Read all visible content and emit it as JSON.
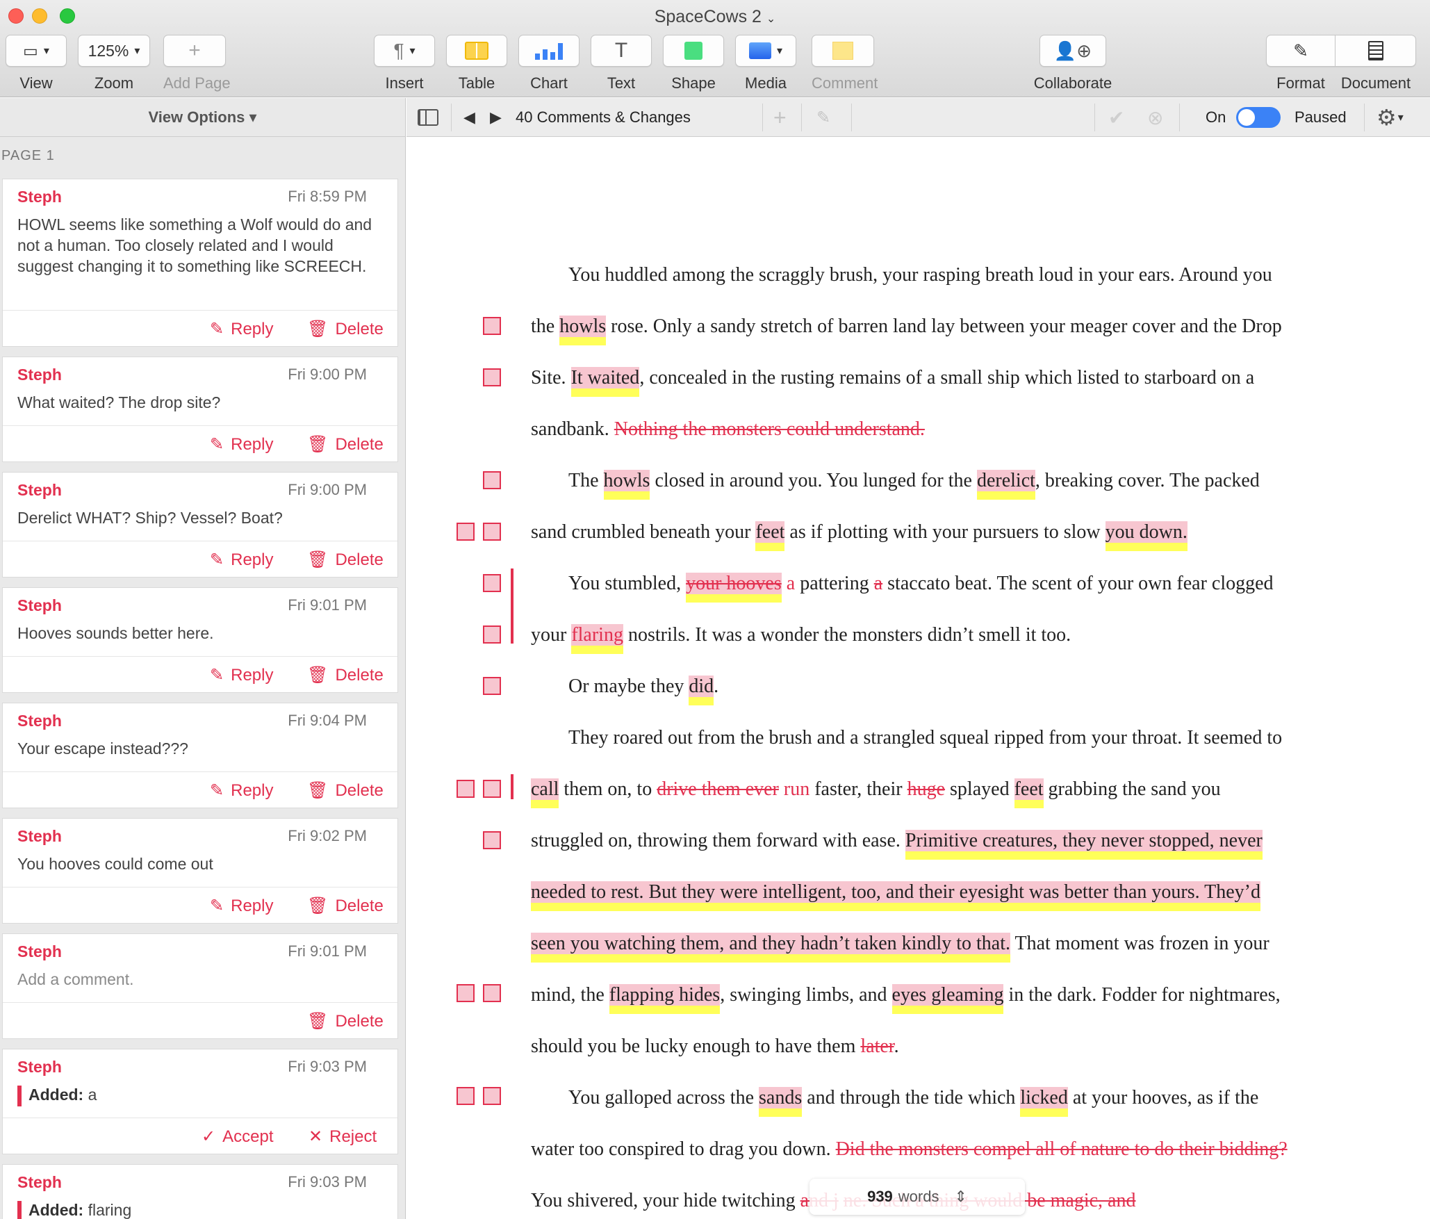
{
  "window": {
    "title": "SpaceCows 2",
    "traffic": [
      "#fd5f57",
      "#febc2e",
      "#29c840"
    ]
  },
  "toolbar": {
    "view": "View",
    "zoom": "Zoom",
    "zoom_value": "125%",
    "add_page": "Add Page",
    "insert": "Insert",
    "table": "Table",
    "chart": "Chart",
    "text": "Text",
    "shape": "Shape",
    "media": "Media",
    "comment": "Comment",
    "collaborate": "Collaborate",
    "format": "Format",
    "document": "Document"
  },
  "sidebar": {
    "view_options": "View Options ▾",
    "page_label": "PAGE 1",
    "reply_label": "Reply",
    "delete_label": "Delete",
    "accept_label": "Accept",
    "reject_label": "Reject",
    "added_label": "Added:",
    "comments": [
      {
        "author": "Steph",
        "time": "Fri 8:59 PM",
        "text": "HOWL seems like something a Wolf would do and not a human. Too closely related and I would suggest changing it to something like SCREECH."
      },
      {
        "author": "Steph",
        "time": "Fri 9:00 PM",
        "text": "What waited? The drop site?"
      },
      {
        "author": "Steph",
        "time": "Fri 9:00 PM",
        "text": "Derelict WHAT? Ship? Vessel? Boat?"
      },
      {
        "author": "Steph",
        "time": "Fri 9:01 PM",
        "text": "Hooves sounds better here."
      },
      {
        "author": "Steph",
        "time": "Fri 9:04 PM",
        "text": "Your escape instead???"
      },
      {
        "author": "Steph",
        "time": "Fri 9:02 PM",
        "text": "You hooves could come out"
      },
      {
        "author": "Steph",
        "time": "Fri 9:01 PM",
        "placeholder": "Add a comment."
      },
      {
        "author": "Steph",
        "time": "Fri 9:03 PM",
        "added": "a"
      },
      {
        "author": "Steph",
        "time": "Fri 9:03 PM",
        "added": "flaring"
      }
    ]
  },
  "comments_bar": {
    "count_label": "40 Comments & Changes",
    "on_label": "On",
    "paused_label": "Paused",
    "tracking_on": true
  },
  "document": {
    "lines": [
      [
        [
          "t",
          "You huddled among the scraggly brush, your rasping breath loud in your ears. Around you"
        ]
      ],
      [
        [
          "t",
          "the "
        ],
        [
          "h",
          "howls"
        ],
        [
          "t",
          " rose. Only a sandy stretch of barren land lay between your meager cover and the Drop"
        ]
      ],
      [
        [
          "t",
          "Site. "
        ],
        [
          "h",
          "It waited"
        ],
        [
          "t",
          ", concealed in the rusting remains of a small ship which listed to starboard on a"
        ]
      ],
      [
        [
          "t",
          "sandbank. "
        ],
        [
          "d",
          "Nothing the monsters could understand."
        ]
      ],
      [
        [
          "t",
          "The "
        ],
        [
          "h",
          "howls"
        ],
        [
          "t",
          " closed in around you. You lunged for the "
        ],
        [
          "h",
          "derelict"
        ],
        [
          "t",
          ", breaking cover. The packed"
        ]
      ],
      [
        [
          "t",
          "sand crumbled beneath your "
        ],
        [
          "h",
          "feet"
        ],
        [
          "t",
          " as if plotting with your pursuers to slow "
        ],
        [
          "h",
          "you down."
        ]
      ],
      [
        [
          "t",
          "You stumbled, "
        ],
        [
          "hd",
          "your hooves"
        ],
        [
          "i",
          " a"
        ],
        [
          "t",
          " pattering "
        ],
        [
          "d",
          "a"
        ],
        [
          "t",
          " staccato beat. The scent of your own fear clogged"
        ]
      ],
      [
        [
          "t",
          "your "
        ],
        [
          "hi",
          "flaring"
        ],
        [
          "t",
          " nostrils. It was a wonder the monsters didn’t smell it too."
        ]
      ],
      [
        [
          "t",
          "Or maybe they "
        ],
        [
          "h",
          "did"
        ],
        [
          "t",
          "."
        ]
      ],
      [
        [
          "t",
          "They roared out from the brush and a strangled squeal ripped from your throat. It seemed to"
        ]
      ],
      [
        [
          "h",
          "call"
        ],
        [
          "t",
          " them on, to "
        ],
        [
          "d",
          "drive them ever"
        ],
        [
          "i",
          " run"
        ],
        [
          "t",
          " faster, their "
        ],
        [
          "d",
          "huge"
        ],
        [
          "t",
          " splayed "
        ],
        [
          "h",
          "feet"
        ],
        [
          "t",
          " grabbing the sand you"
        ]
      ],
      [
        [
          "t",
          "struggled on, throwing them forward with ease. "
        ],
        [
          "h",
          "Primitive creatures, they never stopped, never"
        ]
      ],
      [
        [
          "h",
          "needed to rest. But they were intelligent, too, and their eyesight was better than yours. They’d"
        ]
      ],
      [
        [
          "h",
          "seen you watching them, and they hadn’t taken kindly to that."
        ],
        [
          "t",
          " That moment was frozen in your"
        ]
      ],
      [
        [
          "t",
          "mind, the "
        ],
        [
          "h",
          "flapping hides"
        ],
        [
          "t",
          ", swinging limbs, and "
        ],
        [
          "h",
          "eyes gleaming"
        ],
        [
          "t",
          " in the dark. Fodder for nightmares,"
        ]
      ],
      [
        [
          "t",
          "should you be lucky enough to have them "
        ],
        [
          "d",
          "later"
        ],
        [
          "t",
          "."
        ]
      ],
      [
        [
          "t",
          "You galloped across the "
        ],
        [
          "h",
          "sands"
        ],
        [
          "t",
          " and through the tide which "
        ],
        [
          "h",
          "licked"
        ],
        [
          "t",
          " at your hooves, as if the"
        ]
      ],
      [
        [
          "t",
          "water too conspired to drag you down. "
        ],
        [
          "d",
          "Did the monsters compel all of nature to do their bidding?"
        ]
      ],
      [
        [
          "t",
          "You shivered, your hide twitching "
        ],
        [
          "d",
          "and j"
        ],
        [
          "t",
          "      "
        ],
        [
          "d",
          "ne. Such a thing would be magic, and"
        ]
      ]
    ],
    "word_count": "939",
    "words_label": "words"
  }
}
